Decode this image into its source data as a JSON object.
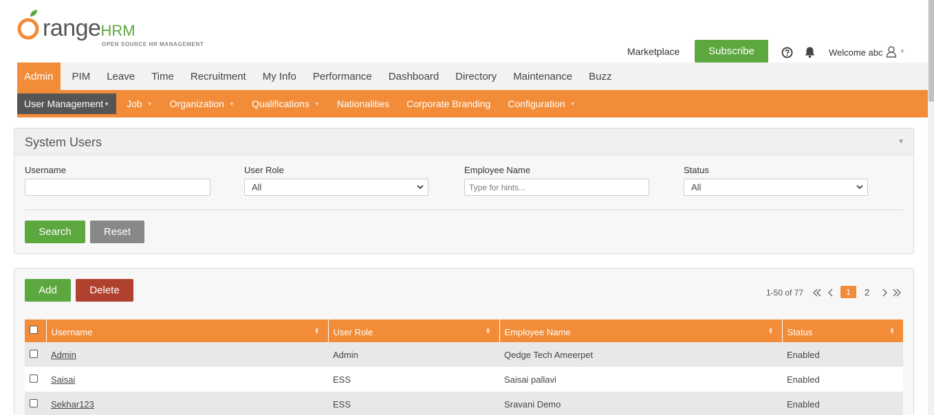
{
  "header": {
    "logo_word": "range",
    "logo_hrm": "HRM",
    "logo_tagline": "OPEN SOURCE HR MANAGEMENT",
    "marketplace": "Marketplace",
    "subscribe": "Subscribe",
    "welcome": "Welcome abc"
  },
  "main_menu": [
    "Admin",
    "PIM",
    "Leave",
    "Time",
    "Recruitment",
    "My Info",
    "Performance",
    "Dashboard",
    "Directory",
    "Maintenance",
    "Buzz"
  ],
  "sub_menu": [
    {
      "label": "User Management",
      "dropdown": true
    },
    {
      "label": "Job",
      "dropdown": true
    },
    {
      "label": "Organization",
      "dropdown": true
    },
    {
      "label": "Qualifications",
      "dropdown": true
    },
    {
      "label": "Nationalities",
      "dropdown": false
    },
    {
      "label": "Corporate Branding",
      "dropdown": false
    },
    {
      "label": "Configuration",
      "dropdown": true
    }
  ],
  "search_panel": {
    "title": "System Users",
    "username_label": "Username",
    "username_value": "",
    "user_role_label": "User Role",
    "user_role_value": "All",
    "employee_name_label": "Employee Name",
    "employee_name_placeholder": "Type for hints...",
    "status_label": "Status",
    "status_value": "All",
    "search_button": "Search",
    "reset_button": "Reset"
  },
  "results": {
    "add_button": "Add",
    "delete_button": "Delete",
    "pager_info": "1-50 of 77",
    "current_page": "1",
    "next_page": "2",
    "columns": [
      "Username",
      "User Role",
      "Employee Name",
      "Status"
    ],
    "rows": [
      {
        "username": "Admin",
        "role": "Admin",
        "employee": "Qedge Tech Ameerpet",
        "status": "Enabled"
      },
      {
        "username": "Saisai",
        "role": "ESS",
        "employee": "Saisai pallavi",
        "status": "Enabled"
      },
      {
        "username": "Sekhar123",
        "role": "ESS",
        "employee": "Sravani Demo",
        "status": "Enabled"
      }
    ]
  },
  "colors": {
    "accent_orange": "#f28c38",
    "green": "#5ca83e",
    "red": "#b0412f"
  }
}
